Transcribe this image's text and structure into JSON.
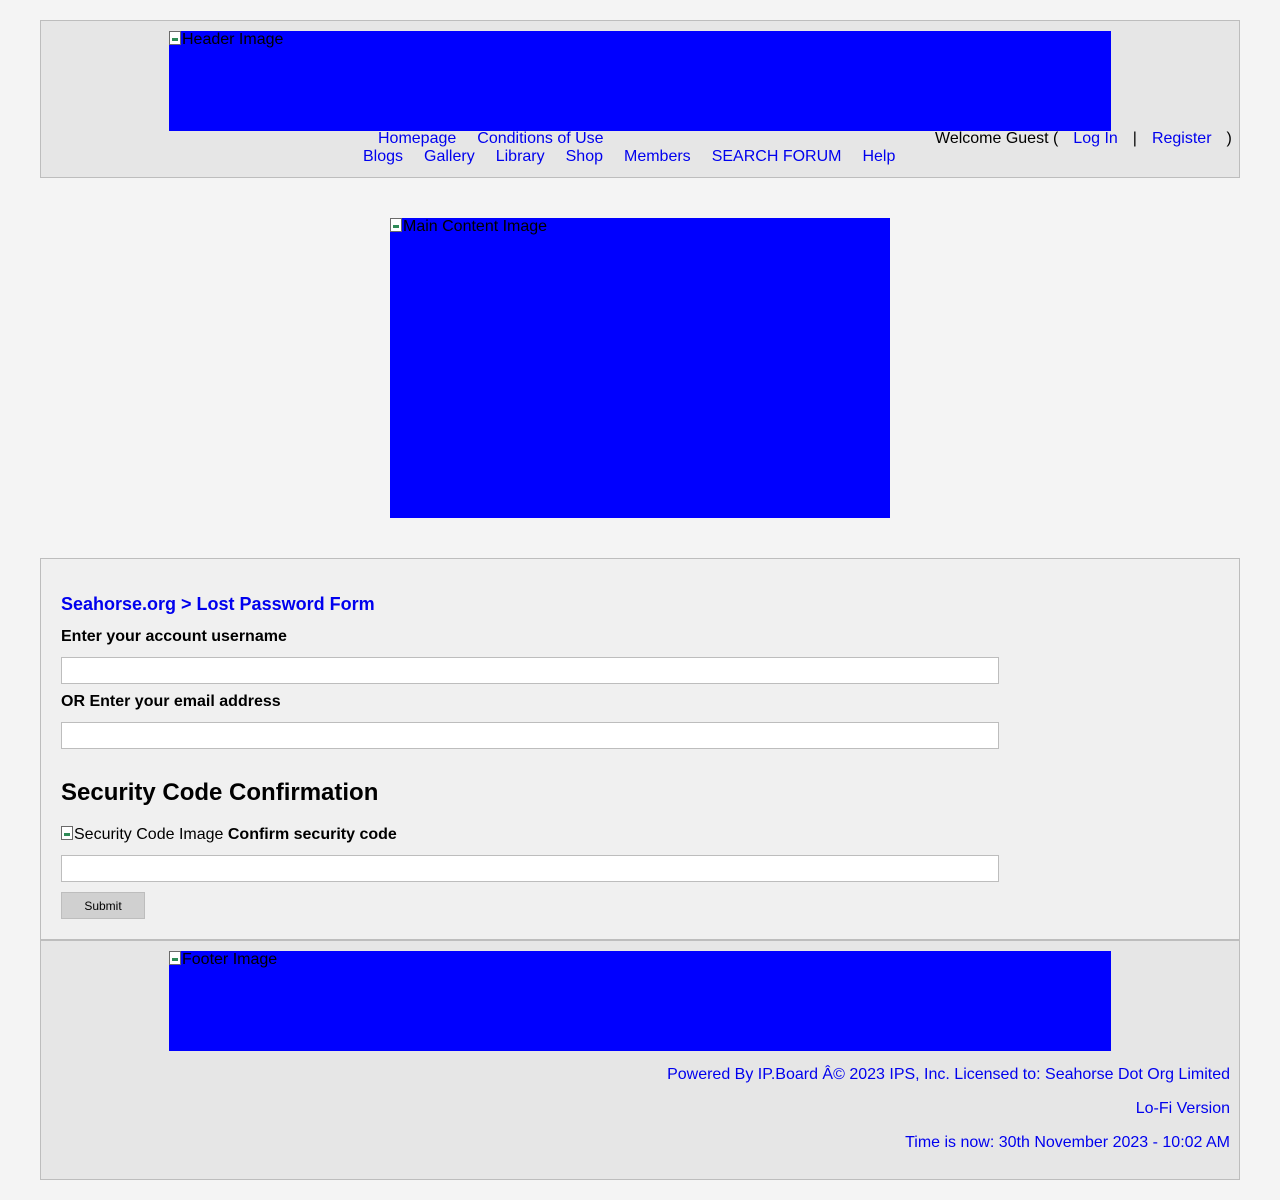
{
  "header": {
    "image_alt": "Header Image",
    "nav_row1": [
      "Homepage",
      "Conditions of Use"
    ],
    "nav_row2": [
      "Blogs",
      "Gallery",
      "Library",
      "Shop",
      "Members",
      "SEARCH FORUM",
      "Help"
    ],
    "welcome_text": "Welcome Guest (",
    "login_label": "Log In",
    "separator": "|",
    "register_label": "Register",
    "close_paren": ")"
  },
  "main": {
    "image_alt": "Main Content Image"
  },
  "form": {
    "title": "Seahorse.org > Lost Password Form",
    "username_label": "Enter your account username",
    "username_value": "",
    "email_label": "OR Enter your email address",
    "email_value": "",
    "security_heading": "Security Code Confirmation",
    "security_image_alt": "Security Code Image",
    "confirm_label": "Confirm security code",
    "confirm_value": "",
    "submit_label": "Submit"
  },
  "footer": {
    "image_alt": "Footer Image",
    "powered_by": "Powered By IP.Board Â© 2023 IPS, Inc. Licensed to: Seahorse Dot Org Limited",
    "lofi_label": "Lo-Fi Version",
    "time_text": "Time is now: 30th November 2023 - 10:02 AM"
  },
  "colors": {
    "placeholder_image": "#0000ff",
    "link": "#0000ee",
    "panel_bg": "#e6e6e6",
    "form_bg": "#f0f0f0",
    "page_bg": "#f4f4f4"
  }
}
